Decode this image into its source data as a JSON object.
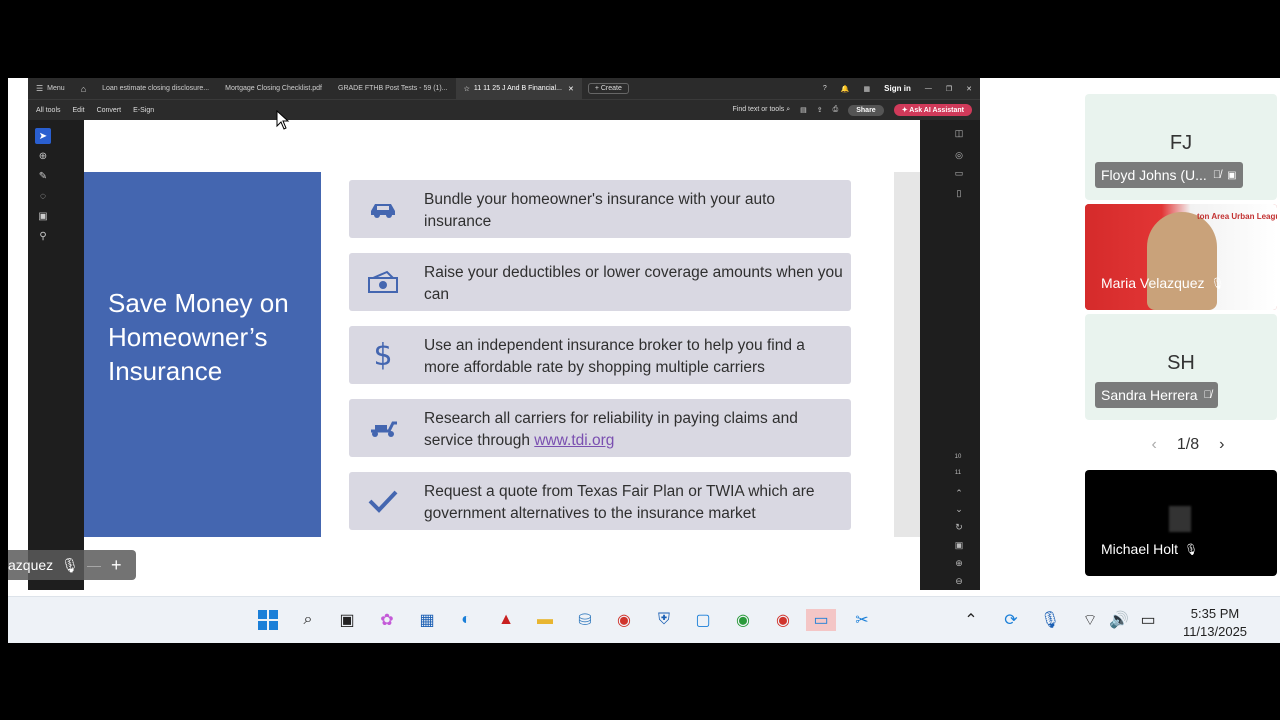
{
  "acrobat": {
    "menu_label": "Menu",
    "tabs": [
      {
        "label": "Loan estimate closing disclosure..."
      },
      {
        "label": "Mortgage Closing Checklist.pdf"
      },
      {
        "label": "GRADE FTHB Post Tests - 59 (1)..."
      },
      {
        "label": "11 11 25 J And B Financial..."
      }
    ],
    "create_label": "Create",
    "sign_in": "Sign in",
    "tools": [
      "All tools",
      "Edit",
      "Convert",
      "E-Sign"
    ],
    "find_label": "Find text or tools",
    "share_label": "Share",
    "ai_label": "Ask AI Assistant",
    "page_indicator": [
      "10",
      "11"
    ]
  },
  "slide": {
    "title": "Save Money on Homeowner’s Insurance",
    "items": [
      {
        "icon": "car-icon",
        "text": "Bundle your homeowner's insurance with your auto insurance"
      },
      {
        "icon": "cash-icon",
        "text": "Raise your deductibles or lower coverage amounts when you can"
      },
      {
        "icon": "dollar-icon",
        "text": "Use an independent insurance  broker to help you find a more affordable rate by shopping multiple carriers"
      },
      {
        "icon": "scooter-icon",
        "text_before": "Research all carriers for reliability in paying claims and service through ",
        "link": "www.tdi.org"
      },
      {
        "icon": "checkmark-icon",
        "text": "Request a quote from Texas Fair Plan or TWIA which are government alternatives to the insurance market"
      }
    ]
  },
  "speaker_tag": "azquez",
  "participants": [
    {
      "initials": "FJ",
      "name": "Floyd Johns (U..."
    },
    {
      "name": "Maria Velazquez",
      "bg_text": "ton Area Urban League"
    },
    {
      "initials": "SH",
      "name": "Sandra Herrera"
    },
    {
      "name": "Michael Holt"
    }
  ],
  "pager": "1/8",
  "clock": {
    "time": "5:35 PM",
    "date": "11/13/2025"
  },
  "colors": {
    "slide_blue": "#4466b0",
    "row_bg": "#d9d8e2",
    "link": "#7a4fb0",
    "ai_button": "#d03a5a"
  }
}
